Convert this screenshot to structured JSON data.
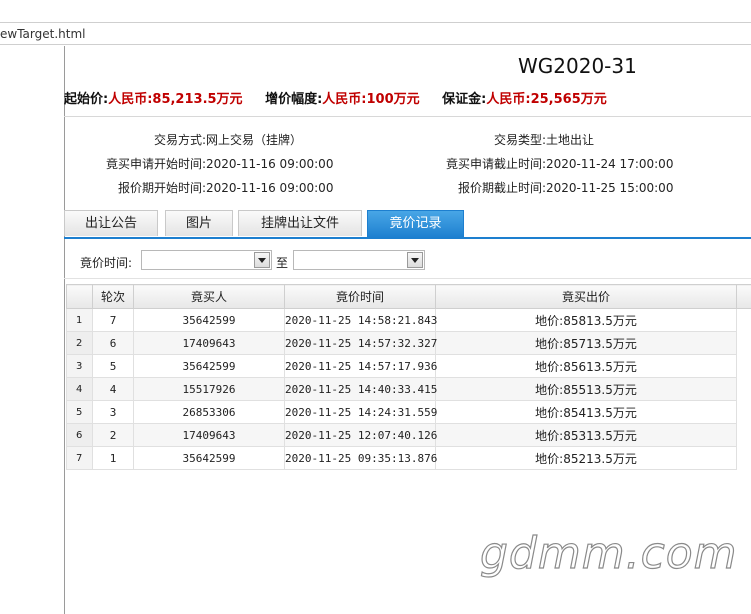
{
  "browser": {
    "address_fragment": "ewTarget.html"
  },
  "header": {
    "title": "WG2020-31"
  },
  "prices": [
    {
      "label": "起始价:",
      "value": "人民币:85,213.5万元"
    },
    {
      "label": "增价幅度:",
      "value": "人民币:100万元"
    },
    {
      "label": "保证金:",
      "value": "人民币:25,565万元"
    }
  ],
  "info": {
    "trade_method": {
      "label": "交易方式:",
      "value": "网上交易（挂牌）"
    },
    "trade_type": {
      "label": "交易类型:",
      "value": "土地出让"
    },
    "apply_start": {
      "label": "竟买申请开始时间:",
      "value": "2020-11-16 09:00:00"
    },
    "apply_end": {
      "label": "竟买申请截止时间:",
      "value": "2020-11-24 17:00:00"
    },
    "quote_start": {
      "label": "报价期开始时间:",
      "value": "2020-11-16 09:00:00"
    },
    "quote_end": {
      "label": "报价期截止时间:",
      "value": "2020-11-25 15:00:00"
    }
  },
  "tabs": [
    {
      "label": "出让公告",
      "active": false
    },
    {
      "label": "图片",
      "active": false
    },
    {
      "label": "挂牌出让文件",
      "active": false
    },
    {
      "label": "竟价记录",
      "active": true
    }
  ],
  "filter": {
    "label": "竟价时间:",
    "from_value": "",
    "to_label": "至",
    "to_value": ""
  },
  "table": {
    "headers": [
      "",
      "轮次",
      "竟买人",
      "竟价时间",
      "竟买出价"
    ],
    "rows": [
      {
        "n": "1",
        "round": "7",
        "bidder": "35642599",
        "time": "2020-11-25 14:58:21.843",
        "bid": "地价:85813.5万元"
      },
      {
        "n": "2",
        "round": "6",
        "bidder": "17409643",
        "time": "2020-11-25 14:57:32.327",
        "bid": "地价:85713.5万元"
      },
      {
        "n": "3",
        "round": "5",
        "bidder": "35642599",
        "time": "2020-11-25 14:57:17.936",
        "bid": "地价:85613.5万元"
      },
      {
        "n": "4",
        "round": "4",
        "bidder": "15517926",
        "time": "2020-11-25 14:40:33.415",
        "bid": "地价:85513.5万元"
      },
      {
        "n": "5",
        "round": "3",
        "bidder": "26853306",
        "time": "2020-11-25 14:24:31.559",
        "bid": "地价:85413.5万元"
      },
      {
        "n": "6",
        "round": "2",
        "bidder": "17409643",
        "time": "2020-11-25 12:07:40.126",
        "bid": "地价:85313.5万元"
      },
      {
        "n": "7",
        "round": "1",
        "bidder": "35642599",
        "time": "2020-11-25 09:35:13.876",
        "bid": "地价:85213.5万元"
      }
    ]
  },
  "watermark": "gdmm.com"
}
